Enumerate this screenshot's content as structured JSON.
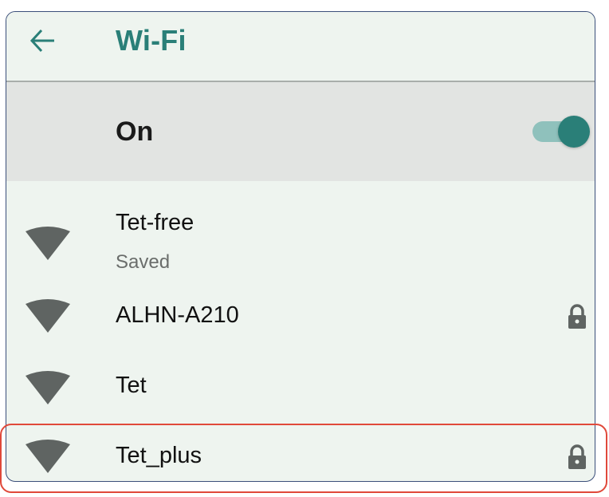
{
  "header": {
    "back_icon": "arrow-left-icon",
    "title": "Wi-Fi"
  },
  "master_switch": {
    "label": "On",
    "state": "on",
    "icon": "toggle-switch"
  },
  "networks": [
    {
      "name": "Tet-free",
      "status": "Saved",
      "secured": false,
      "icon": "wifi-signal-icon"
    },
    {
      "name": "ALHN-A210",
      "status": "",
      "secured": true,
      "icon": "wifi-signal-icon"
    },
    {
      "name": "Tet",
      "status": "",
      "secured": false,
      "icon": "wifi-signal-icon"
    },
    {
      "name": "Tet_plus",
      "status": "",
      "secured": true,
      "icon": "wifi-signal-icon"
    }
  ],
  "highlighted_network": "Tet_plus",
  "colors": {
    "accent": "#2a7f78",
    "background": "#eef4ef",
    "master_row_bg": "#e2e4e2",
    "highlight": "#e0493a",
    "icon_gray": "#5f6462"
  }
}
